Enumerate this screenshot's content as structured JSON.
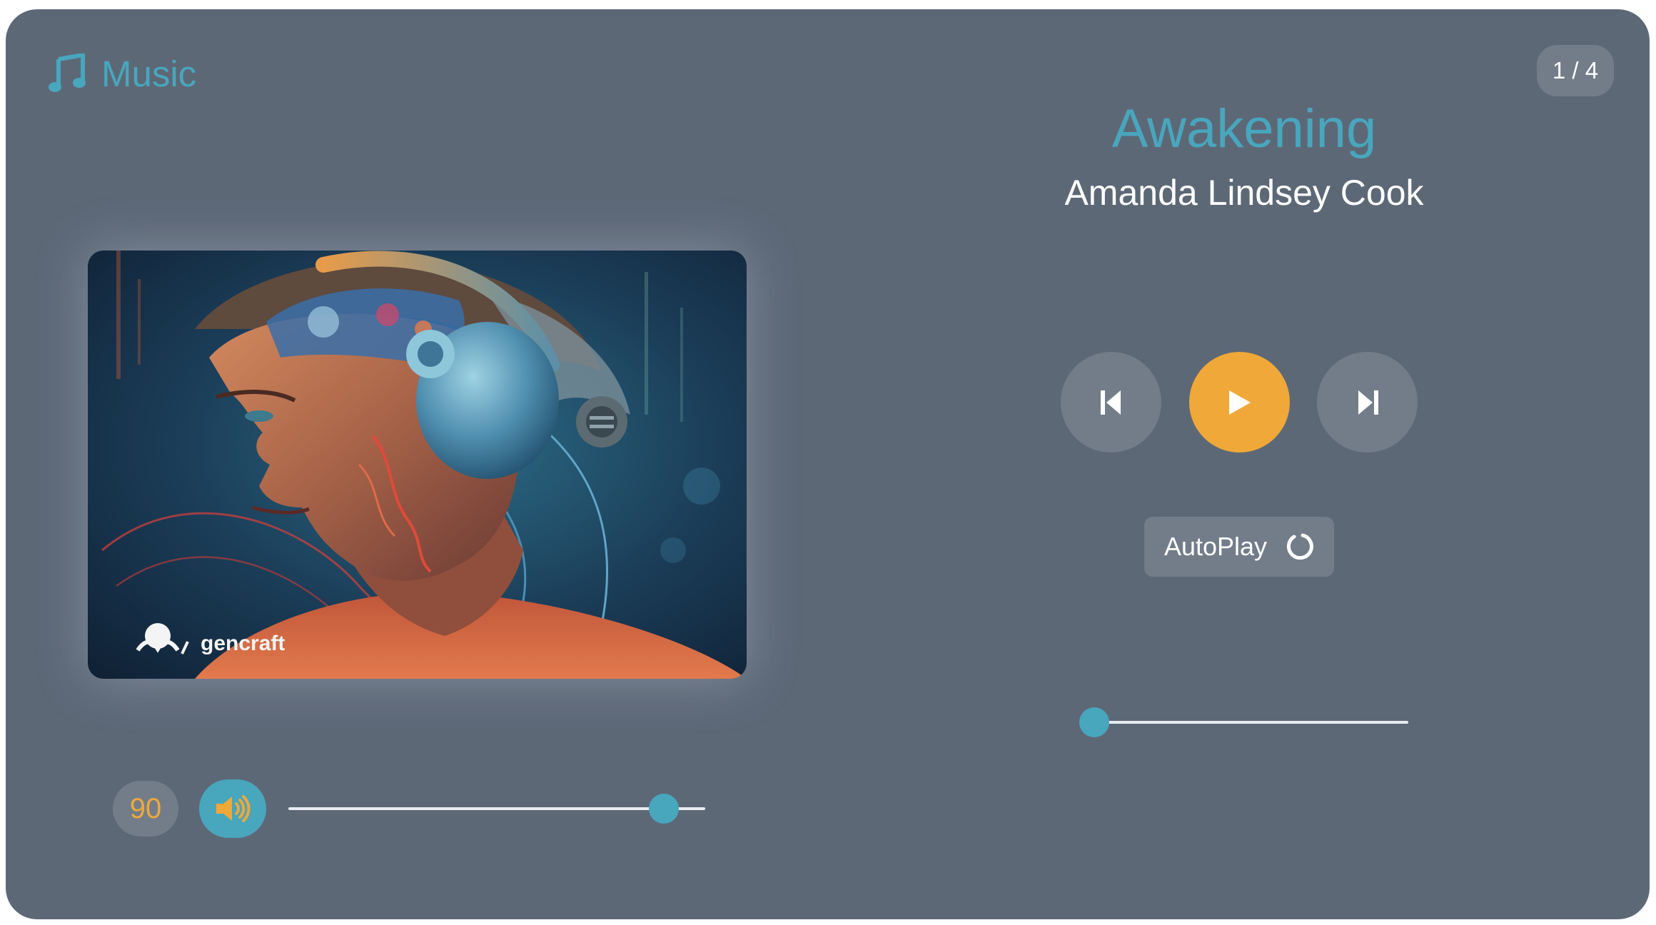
{
  "app": {
    "name": "Music",
    "icon": "music-note-icon",
    "accent_color": "#48a6bd",
    "highlight_color": "#f0a838"
  },
  "playlist": {
    "counter": "1 / 4",
    "current_index": 1,
    "total": 4
  },
  "track": {
    "title": "Awakening",
    "artist": "Amanda Lindsey Cook",
    "cover_watermark": "gencraft"
  },
  "controls": {
    "prev_icon": "skip-previous-icon",
    "play_icon": "play-icon",
    "next_icon": "skip-next-icon",
    "autoplay_label": "AutoPlay",
    "autoplay_icon": "refresh-icon"
  },
  "progress": {
    "fraction": 0.0
  },
  "volume": {
    "value": "90",
    "level": 0.9,
    "icon": "speaker-volume-icon"
  }
}
